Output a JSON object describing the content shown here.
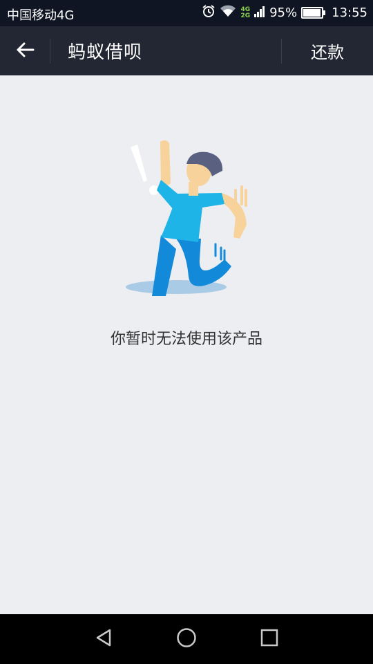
{
  "status_bar": {
    "carrier": "中国移动4G",
    "alarm_icon": "alarm-clock-icon",
    "wifi_icon": "wifi-icon",
    "network_tag_top": "4G",
    "network_tag_bottom": "2G",
    "battery_percent_text": "95%",
    "battery_level": 0.95,
    "time": "13:55"
  },
  "title_bar": {
    "back_icon": "arrow-left-icon",
    "title": "蚂蚁借呗",
    "action_label": "还款"
  },
  "content": {
    "illustration": "person-startled-icon",
    "message": "你暂时无法使用该产品"
  },
  "nav_bar": {
    "back_icon": "triangle-back-icon",
    "home_icon": "circle-home-icon",
    "recents_icon": "square-recents-icon"
  },
  "colors": {
    "status_bar_bg": "#0F1522",
    "title_bar_bg": "#232733",
    "page_bg": "#EDEEF2",
    "figure_shirt": "#1EB4E8",
    "figure_pants": "#1289D9",
    "figure_skin": "#F8D29B",
    "figure_hair": "#5A6080"
  }
}
